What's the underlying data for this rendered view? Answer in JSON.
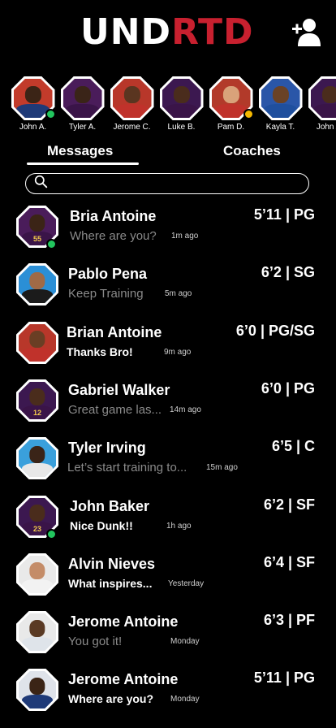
{
  "app": {
    "logo_part1": "UND",
    "logo_part2": "RTD"
  },
  "stories": [
    {
      "label": "John A.",
      "status": "online",
      "colors": {
        "bg": "#c23b2b",
        "skin": "#3b2416",
        "jersey": "#1f3a78"
      }
    },
    {
      "label": "Tyler A.",
      "status": "none",
      "colors": {
        "bg": "#4a1c5a",
        "skin": "#3a2418",
        "jersey": "#3a1448"
      }
    },
    {
      "label": "Jerome C.",
      "status": "none",
      "colors": {
        "bg": "#b8372a",
        "skin": "#5a3520",
        "jersey": "#c0322b"
      }
    },
    {
      "label": "Luke B.",
      "status": "none",
      "colors": {
        "bg": "#3c1850",
        "skin": "#4a2c1c",
        "jersey": "#3a1448"
      }
    },
    {
      "label": "Pam D.",
      "status": "away",
      "colors": {
        "bg": "#b23a2a",
        "skin": "#d9a27a",
        "jersey": "#c0322b"
      }
    },
    {
      "label": "Kayla T.",
      "status": "none",
      "colors": {
        "bg": "#2a56a8",
        "skin": "#6a4226",
        "jersey": "#1f4f9e"
      }
    },
    {
      "label": "John A.",
      "status": "online",
      "colors": {
        "bg": "#3c1850",
        "skin": "#4a2c1c",
        "jersey": "#3a1448"
      }
    }
  ],
  "tabs": {
    "messages": "Messages",
    "coaches": "Coaches"
  },
  "search": {
    "placeholder": ""
  },
  "messages": [
    {
      "name": "Bria Antoine",
      "stat": "5’11 | PG",
      "preview": "Where are you?",
      "time": "1m ago",
      "unread": false,
      "status": "online",
      "colors": {
        "bg": "#4a1c5a",
        "skin": "#3b2416",
        "jersey": "#3a1448"
      },
      "jersey_number": "55"
    },
    {
      "name": "Pablo Pena",
      "stat": "6’2 | SG",
      "preview": "Keep Training",
      "time": "5m ago",
      "unread": false,
      "status": "none",
      "colors": {
        "bg": "#2b8fd6",
        "skin": "#a06a46",
        "jersey": "#1b1b1b"
      },
      "jersey_number": ""
    },
    {
      "name": "Brian Antoine",
      "stat": "6’0 | PG/SG",
      "preview": "Thanks Bro!",
      "time": "9m ago",
      "unread": true,
      "status": "none",
      "colors": {
        "bg": "#b8372a",
        "skin": "#6a3e24",
        "jersey": "#c0322b"
      },
      "jersey_number": ""
    },
    {
      "name": "Gabriel Walker",
      "stat": "6’0 | PG",
      "preview": "Great game las...",
      "time": "14m ago",
      "unread": false,
      "status": "none",
      "colors": {
        "bg": "#3c1850",
        "skin": "#4a2c1c",
        "jersey": "#3a1448"
      },
      "jersey_number": "12"
    },
    {
      "name": "Tyler Irving",
      "stat": "6’5 | C",
      "preview": "Let’s start training to...",
      "time": "15m ago",
      "unread": false,
      "status": "none",
      "colors": {
        "bg": "#3aa0dc",
        "skin": "#3a2418",
        "jersey": "#e8e8e8"
      },
      "jersey_number": ""
    },
    {
      "name": "John Baker",
      "stat": "6’2 | SF",
      "preview": "Nice Dunk!!",
      "time": "1h ago",
      "unread": true,
      "status": "online",
      "colors": {
        "bg": "#3c1850",
        "skin": "#4a2c1c",
        "jersey": "#3a1448"
      },
      "jersey_number": "23"
    },
    {
      "name": "Alvin Nieves",
      "stat": "6’4 | SF",
      "preview": "What inspires...",
      "time": "Yesterday",
      "unread": true,
      "status": "none",
      "colors": {
        "bg": "#e9e9e9",
        "skin": "#c48c68",
        "jersey": "#f2f2f2"
      },
      "jersey_number": ""
    },
    {
      "name": "Jerome Antoine",
      "stat": "6’3 | PF",
      "preview": "You got it!",
      "time": "Monday",
      "unread": false,
      "status": "none",
      "colors": {
        "bg": "#e9e9e9",
        "skin": "#5a3a24",
        "jersey": "#dfe4ea"
      },
      "jersey_number": ""
    },
    {
      "name": "Jerome Antoine",
      "stat": "5’11 | PG",
      "preview": "Where are you?",
      "time": "Monday",
      "unread": true,
      "status": "none",
      "colors": {
        "bg": "#dfe3ea",
        "skin": "#3b2416",
        "jersey": "#1f3a78"
      },
      "jersey_number": ""
    }
  ],
  "status_colors": {
    "online": "#22c55e",
    "away": "#f5b800"
  }
}
